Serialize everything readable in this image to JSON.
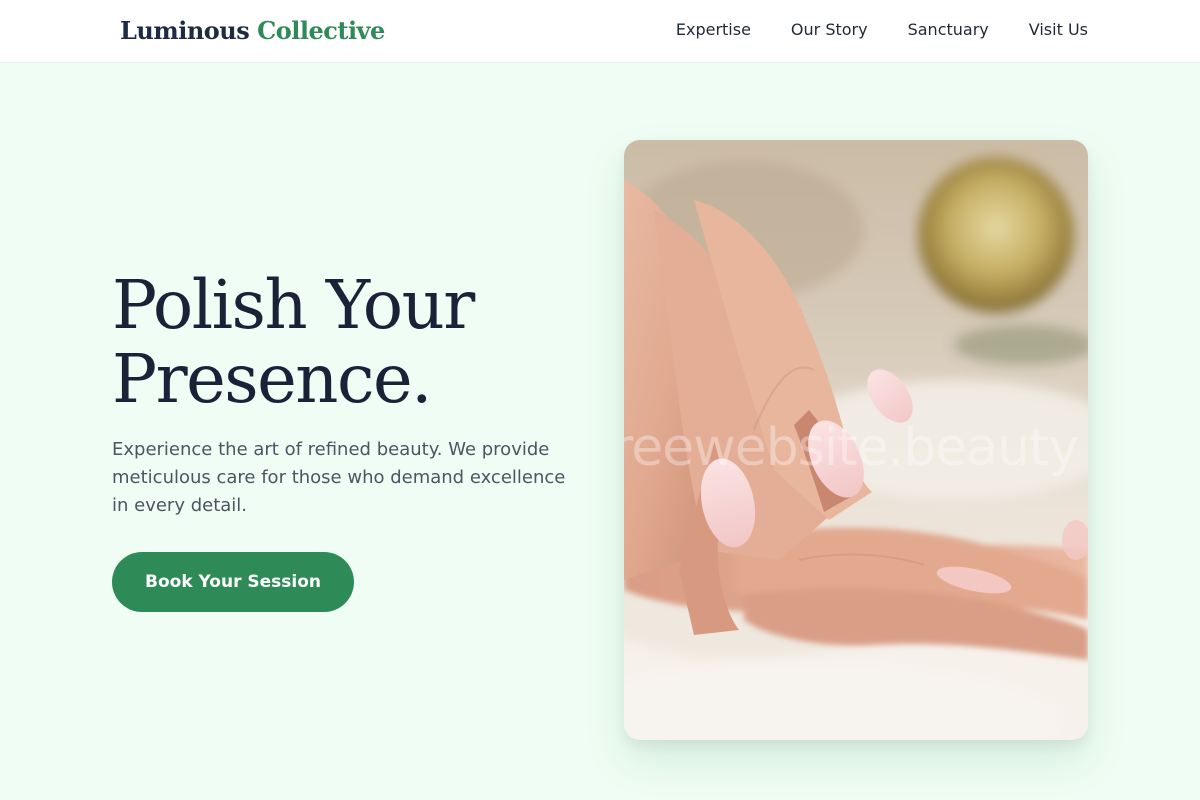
{
  "brand": {
    "name_part1": "Luminous",
    "name_part2": "Collective"
  },
  "nav": {
    "items": [
      {
        "label": "Expertise"
      },
      {
        "label": "Our Story"
      },
      {
        "label": "Sanctuary"
      },
      {
        "label": "Visit Us"
      }
    ]
  },
  "hero": {
    "title_line1": "Polish Your",
    "title_line2": "Presence.",
    "subtitle": "Experience the art of refined beauty. We provide meticulous care for those who demand excellence in every detail.",
    "cta_label": "Book Your Session",
    "image_watermark": "reewebsite.beauty"
  },
  "colors": {
    "page_background": "#f0fdf4",
    "brand_green": "#2e8b57",
    "heading_navy": "#1a2238"
  }
}
